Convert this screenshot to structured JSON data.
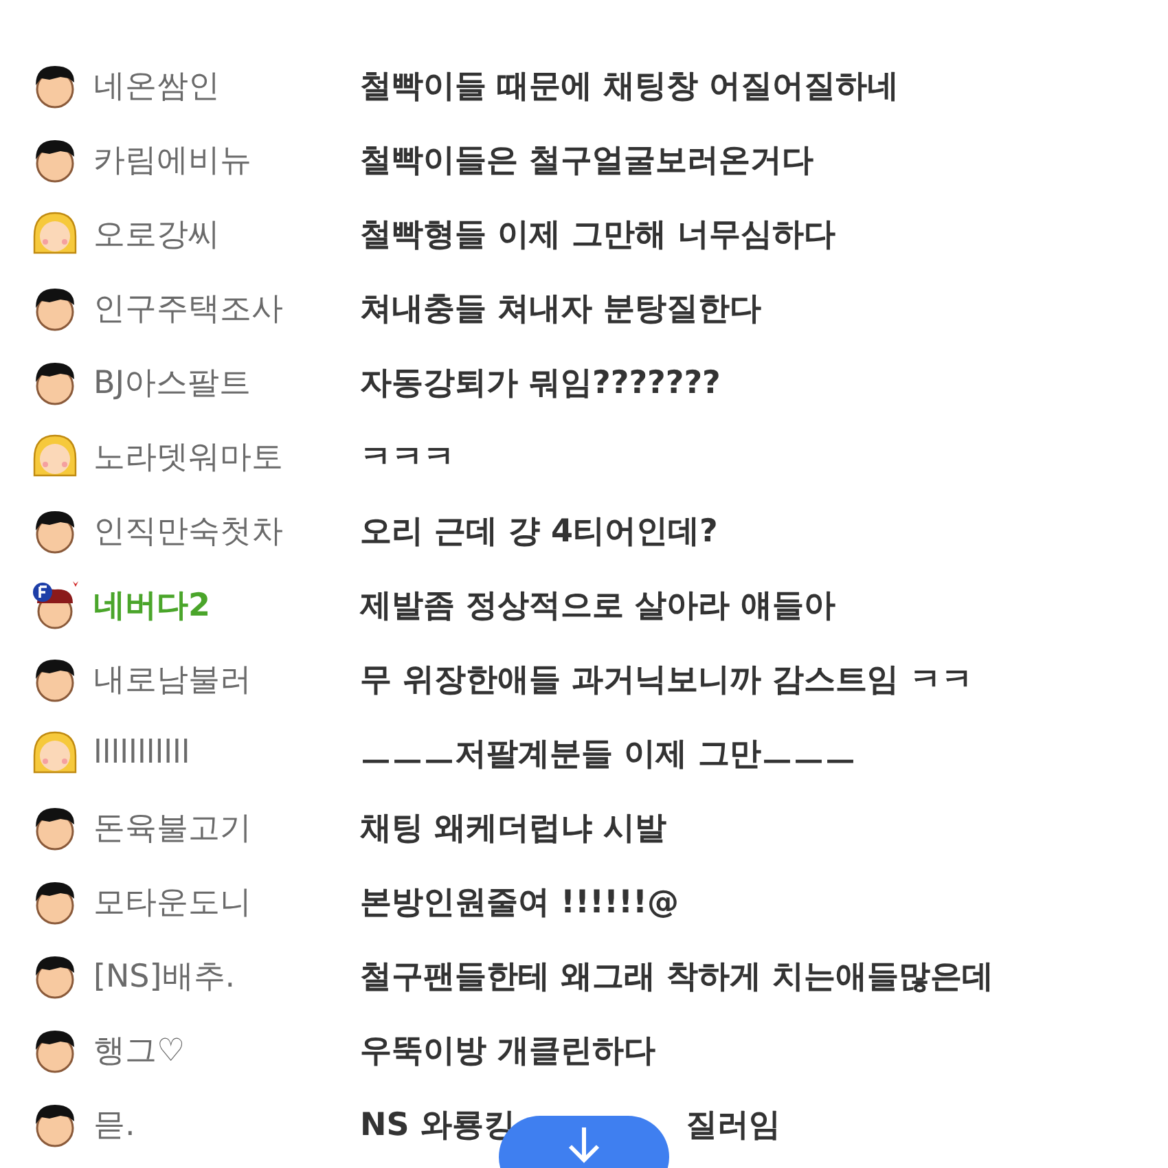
{
  "messages": [
    {
      "kind": "boy",
      "name": "네온쌈인",
      "text": "철빡이들 때문에 채팅창 어질어질하네"
    },
    {
      "kind": "boy",
      "name": "카림에비뉴",
      "text": "철빡이들은 철구얼굴보러온거다"
    },
    {
      "kind": "girl",
      "name": "오로강씨",
      "text": "철빡형들 이제 그만해 너무심하다"
    },
    {
      "kind": "boy",
      "name": "인구주택조사",
      "text": "쳐내충들 쳐내자 분탕질한다"
    },
    {
      "kind": "boy",
      "name": "BJ아스팔트",
      "text": "자동강퇴가 뭐임???????"
    },
    {
      "kind": "girl",
      "name": "노라뎃워마토",
      "text": "ㅋㅋㅋ"
    },
    {
      "kind": "boy",
      "name": "인직만숙첫차",
      "text": "오리 근데 걍 4티어인데?"
    },
    {
      "kind": "fan",
      "name": "네버다2",
      "text": "제발좀 정상적으로 살아라 얘들아"
    },
    {
      "kind": "boy",
      "name": "내로남불러",
      "text": "무 위장한애들 과거닉보니까 감스트임 ㅋㅋ"
    },
    {
      "kind": "girl",
      "name": "lllllllllll",
      "text": "ㅡㅡㅡ저팔계분들 이제 그만ㅡㅡㅡ"
    },
    {
      "kind": "boy",
      "name": "돈육불고기",
      "text": "채팅 왜케더럽냐 시발"
    },
    {
      "kind": "boy",
      "name": "모타운도니",
      "text": "본방인원줄여 !!!!!!@"
    },
    {
      "kind": "boy",
      "name": "[NS]배추.",
      "text": "철구팬들한테 왜그래 착하게 치는애들많은데"
    },
    {
      "kind": "boy",
      "name": "행그♡",
      "text": "우뚝이방 개클린하다"
    },
    {
      "kind": "boy",
      "name": "믇.",
      "text_parts": [
        "NS 와룡킹",
        "질러임"
      ]
    }
  ]
}
